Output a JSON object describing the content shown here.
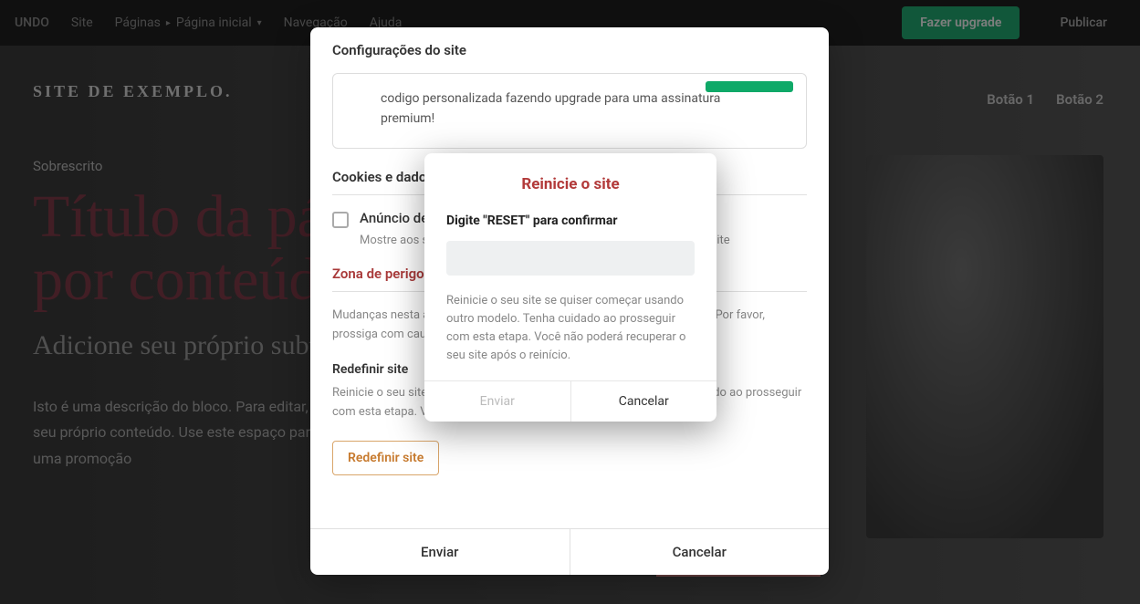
{
  "topnav": {
    "undo": "UNDO",
    "site": "Site",
    "pages": "Páginas",
    "home": "Página inicial",
    "nav": "Navegação",
    "help": "Ajuda",
    "upgrade": "Fazer upgrade",
    "publish": "Publicar"
  },
  "page": {
    "logo": "SITE DE EXEMPLO.",
    "button1": "Botão 1",
    "button2": "Botão 2",
    "sobrescrito": "Sobrescrito",
    "title": "Título da página. Substitua-o por conteúdo próprio",
    "subtitle": "Adicione seu próprio subtítulo aqui.",
    "desc": "Isto é uma descrição do bloco. Para editar, clique e escreva seu texto e substitua-o por seu próprio conteúdo. Use este espaço para converter visitantes do site em clientes com uma promoção"
  },
  "settings": {
    "title": "Configurações do site",
    "promo_text": "codigo personalizada fazendo upgrade para uma assinatura premium!",
    "cookies_h": "Cookies e dados",
    "cookie_cb_label": "Anúncio de cookie",
    "cookie_cb_help": "Mostre aos seus visitantes uma mensagem sobre cookies em seu site",
    "danger_h": "Zona de perigo",
    "danger_help": "Mudanças nesta área podem causar mudanças irreversíveis ao seu site. Por favor, prossiga com cautela.",
    "reset_h": "Redefinir site",
    "reset_help": "Reinicie o seu site se quiser começar usando outro modelo. Tenha cuidado ao prosseguir com esta etapa. Você não poderá recuperar o seu site.",
    "reset_btn": "Redefinir site",
    "footer_submit": "Enviar",
    "footer_cancel": "Cancelar"
  },
  "confirm": {
    "title": "Reinicie o site",
    "label": "Digite \"RESET\" para confirmar",
    "input_value": "",
    "help": "Reinicie o seu site se quiser começar usando outro modelo. Tenha cuidado ao prosseguir com esta etapa. Você não poderá recuperar o seu site após o reinício.",
    "submit": "Enviar",
    "cancel": "Cancelar"
  }
}
